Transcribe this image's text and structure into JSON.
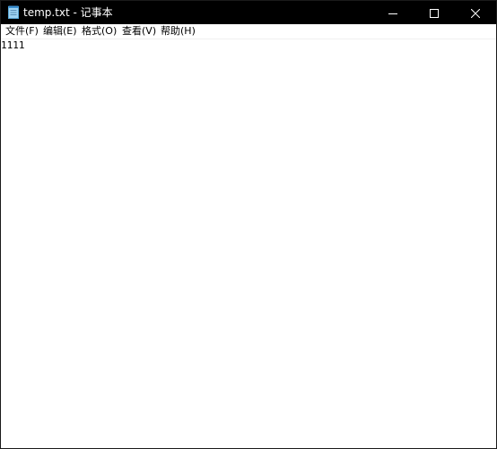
{
  "window": {
    "title": "temp.txt - 记事本",
    "icon": "notepad-icon",
    "controls": {
      "minimize_icon": "minimize-icon",
      "maximize_icon": "maximize-icon",
      "close_icon": "close-icon"
    },
    "colors": {
      "titlebar_bg": "#000000",
      "titlebar_fg": "#ffffff",
      "editor_bg": "#ffffff"
    }
  },
  "menu": {
    "items": [
      {
        "label": "文件(F)"
      },
      {
        "label": "编辑(E)"
      },
      {
        "label": "格式(O)"
      },
      {
        "label": "查看(V)"
      },
      {
        "label": "帮助(H)"
      }
    ]
  },
  "editor": {
    "content": "1111"
  }
}
